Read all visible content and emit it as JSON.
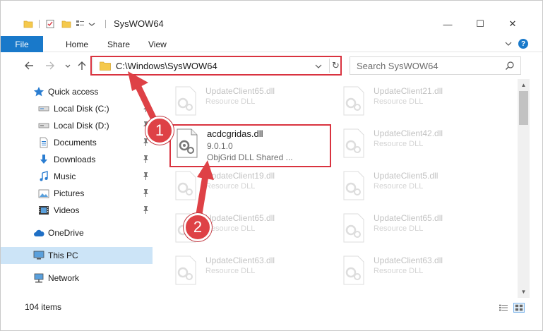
{
  "window": {
    "title": "SysWOW64",
    "controls": {
      "minimize": "—",
      "maximize": "☐",
      "close": "✕"
    }
  },
  "ribbon": {
    "tabs": [
      {
        "label": "File",
        "active": true
      },
      {
        "label": "Home"
      },
      {
        "label": "Share"
      },
      {
        "label": "View"
      }
    ],
    "help_label": "?"
  },
  "nav": {
    "address": "C:\\Windows\\SysWOW64",
    "search_placeholder": "Search SysWOW64"
  },
  "sidebar": {
    "items": [
      {
        "label": "Quick access",
        "icon": "star-icon"
      },
      {
        "label": "Local Disk (C:)",
        "icon": "drive-icon",
        "pinned": true
      },
      {
        "label": "Local Disk (D:)",
        "icon": "drive-icon",
        "pinned": true
      },
      {
        "label": "Documents",
        "icon": "documents-icon",
        "pinned": true
      },
      {
        "label": "Downloads",
        "icon": "downloads-icon",
        "pinned": true
      },
      {
        "label": "Music",
        "icon": "music-icon",
        "pinned": true
      },
      {
        "label": "Pictures",
        "icon": "pictures-icon",
        "pinned": true
      },
      {
        "label": "Videos",
        "icon": "videos-icon",
        "pinned": true
      },
      {
        "label": "OneDrive",
        "icon": "cloud-icon"
      },
      {
        "label": "This PC",
        "icon": "computer-icon",
        "selected": true
      },
      {
        "label": "Network",
        "icon": "network-icon"
      }
    ]
  },
  "files": {
    "main": {
      "name": "acdcgridas.dll",
      "version": "9.0.1.0",
      "description": "ObjGrid DLL Shared ..."
    },
    "background": [
      {
        "name": "UpdateClient65.dll",
        "type": "Resource DLL"
      },
      {
        "name": "UpdateClient21.dll",
        "type": "Resource DLL"
      },
      {
        "name": "UpdateClient42.dll",
        "type": "Resource DLL"
      },
      {
        "name": "UpdateClient19.dll",
        "type": "Resource DLL"
      },
      {
        "name": "UpdateClient5.dll",
        "type": "Resource DLL"
      },
      {
        "name": "UpdateClient65.dll",
        "type": "Resource DLL"
      },
      {
        "name": "UpdateClient65.dll",
        "type": "Resource DLL"
      },
      {
        "name": "UpdateClient63.dll",
        "type": "Resource DLL"
      },
      {
        "name": "UpdateClient63.dll",
        "type": "Resource DLL"
      }
    ]
  },
  "status": {
    "item_count": "104 items"
  },
  "annotations": {
    "step1": "1",
    "step2": "2"
  },
  "colors": {
    "accent": "#1979ca",
    "highlight": "#d9333f",
    "callout": "#de4146",
    "selected": "#cce4f7"
  }
}
